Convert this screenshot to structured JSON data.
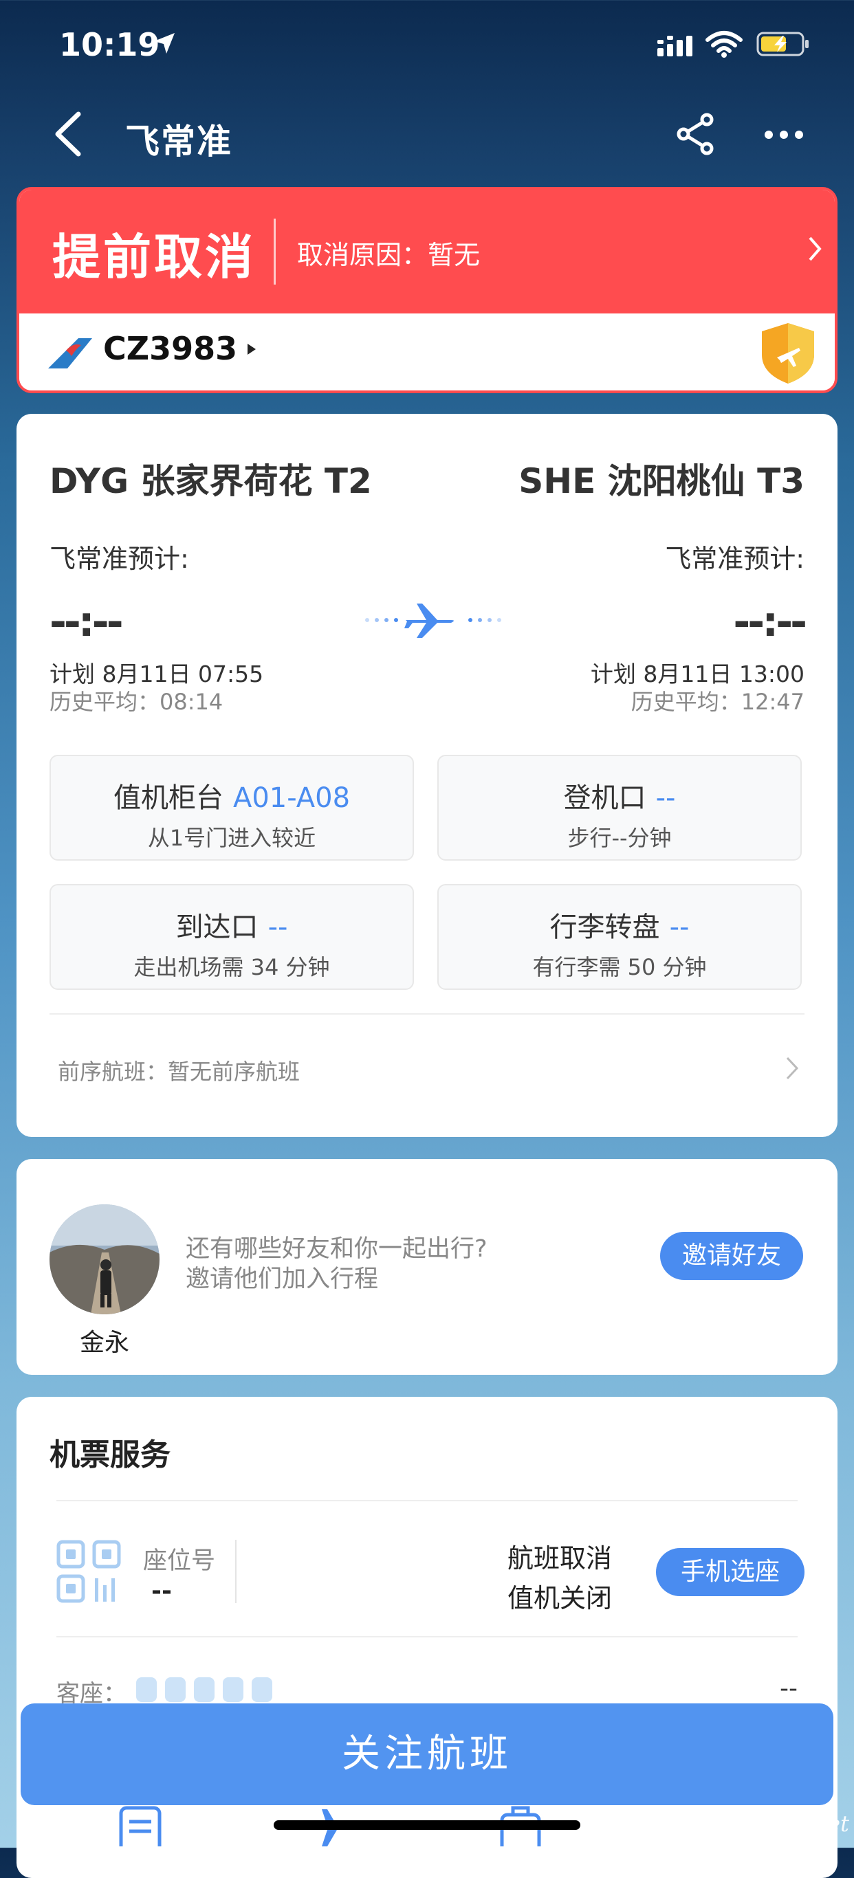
{
  "status_bar": {
    "time": "10:19"
  },
  "nav": {
    "title": "飞常准"
  },
  "cancel_banner": {
    "status": "提前取消",
    "reason": "取消原因：暂无",
    "flight_no": "CZ3983",
    "colors": {
      "banner": "#ff4c4f"
    }
  },
  "route": {
    "departure": {
      "city": "DYG 张家界荷花 T2",
      "predict_label": "飞常准预计:",
      "predict_time": "--:--",
      "plan": "计划 8月11日 07:55",
      "history": "历史平均：08:14"
    },
    "arrival": {
      "city": "SHE 沈阳桃仙 T3",
      "predict_label": "飞常准预计:",
      "predict_time": "--:--",
      "plan": "计划 8月11日 13:00",
      "history": "历史平均：12:47"
    }
  },
  "info_boxes": [
    {
      "title": "值机柜台",
      "value": "A01-A08",
      "sub": "从1号门进入较近"
    },
    {
      "title": "登机口",
      "value": "--",
      "sub": "步行--分钟"
    },
    {
      "title": "到达口",
      "value": "--",
      "sub": "走出机场需 34 分钟"
    },
    {
      "title": "行李转盘",
      "value": "--",
      "sub": "有行李需 50 分钟"
    }
  ],
  "previous_flight": "前序航班：暂无前序航班",
  "friends": {
    "name": "金永",
    "text1": "还有哪些好友和你一起出行?",
    "text2": "邀请他们加入行程",
    "invite_label": "邀请好友"
  },
  "service": {
    "title": "机票服务",
    "seat_label": "座位号",
    "seat_value": "--",
    "status1": "航班取消",
    "status2": "值机关闭",
    "select_label": "手机选座",
    "seat_type_label": "客座：",
    "seat_type_value": "--"
  },
  "follow_label": "关注航班",
  "watermark": "eLvXing.net",
  "colors": {
    "accent": "#4a8cf0",
    "cancel": "#ff4c4f"
  }
}
